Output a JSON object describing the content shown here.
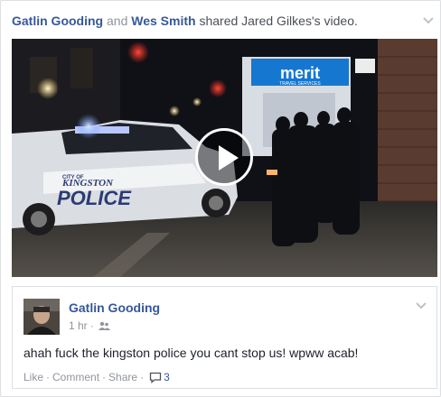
{
  "header": {
    "actor1": "Gatlin Gooding",
    "conj": "and",
    "actor2": "Wes Smith",
    "action": "shared Jared Gilkes's video."
  },
  "video": {
    "store_sign": "merit",
    "store_sub": "TRAVEL SERVICES",
    "car_city": "CITY OF",
    "car_name": "KINGSTON",
    "car_word": "POLICE"
  },
  "post": {
    "author": "Gatlin Gooding",
    "time": "1 hr",
    "audience_icon": "friends-icon",
    "message": "ahah fuck the kingston police you cant stop us! wpww acab!",
    "actions": {
      "like": "Like",
      "comment": "Comment",
      "share": "Share",
      "comment_count": "3"
    }
  },
  "colors": {
    "link_blue": "#365899",
    "meta_gray": "#90949c",
    "sign_blue": "#1677d1"
  }
}
